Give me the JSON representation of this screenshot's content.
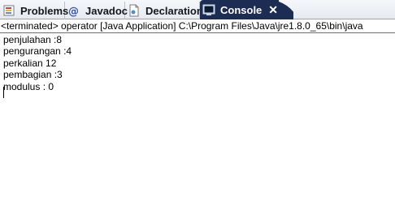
{
  "tabs": [
    {
      "label": "Problems",
      "icon": "problems-icon"
    },
    {
      "label": "Javadoc",
      "icon": "at-sign-icon"
    },
    {
      "label": "Declaration",
      "icon": "declaration-icon"
    },
    {
      "label": "Console",
      "icon": "console-icon",
      "active": true,
      "close_glyph": "✕"
    }
  ],
  "status": "<terminated> operator [Java Application] C:\\Program Files\\Java\\jre1.8.0_65\\bin\\java",
  "console_output": [
    "penjulahan :8",
    "pengurangan :4",
    "perkalian 12",
    "pembagian :3",
    "modulus : 0"
  ],
  "colors": {
    "active_tab_bg": "#1c2c52",
    "active_tab_fg": "#ffffff"
  }
}
